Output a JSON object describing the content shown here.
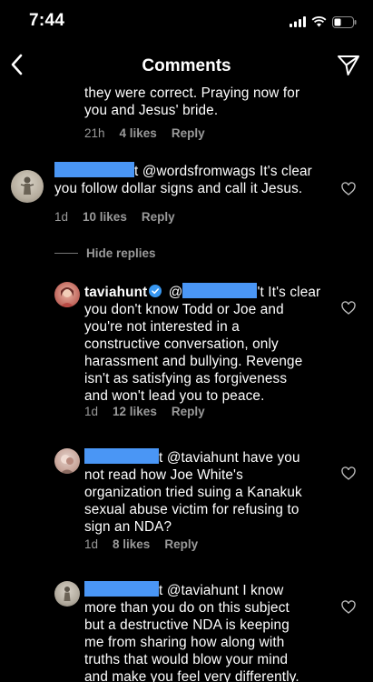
{
  "status": {
    "time": "7:44"
  },
  "nav": {
    "title": "Comments"
  },
  "comments": [
    {
      "text_lines": [
        "they were correct. Praying now for",
        "you and Jesus' bride."
      ],
      "time": "21h",
      "likes": "4 likes",
      "reply": "Reply"
    },
    {
      "suffix": "t",
      "text_first": "@wordsfromwags It's clear",
      "text_lines": [
        "you follow dollar signs and call it Jesus."
      ],
      "time": "1d",
      "likes": "10 likes",
      "reply": "Reply"
    }
  ],
  "hide_replies": "Hide replies",
  "replies": [
    {
      "username": "taviahunt",
      "mention_start": "@",
      "text_first": "'t It's clear",
      "text_lines": [
        "you don't know Todd or Joe and",
        "you're not interested in a",
        "constructive conversation, only",
        "harassment and bullying. Revenge",
        "isn't as satisfying as forgiveness",
        "and won't lead you to peace."
      ],
      "time": "1d",
      "likes": "12 likes",
      "reply": "Reply"
    },
    {
      "suffix": "t",
      "text_first": "@taviahunt have you",
      "text_lines": [
        "not read how Joe White's",
        "organization tried suing a Kanakuk",
        "sexual abuse victim for refusing to",
        "sign an NDA?"
      ],
      "time": "1d",
      "likes": "8 likes",
      "reply": "Reply"
    },
    {
      "suffix": "t",
      "text_first": "@taviahunt I know",
      "text_lines": [
        "more than you do on this subject",
        "but a destructive NDA is keeping",
        "me from sharing how along with",
        "truths that would blow your mind",
        "and make you feel very differently."
      ]
    }
  ],
  "icons": {
    "back": "chevron-left-icon",
    "send": "paper-plane-icon",
    "heart": "heart-outline-icon",
    "verified": "verified-badge-icon"
  },
  "colors": {
    "redaction": "#4a96f5",
    "verified": "#3897f0",
    "meta": "#9a9a9a"
  }
}
